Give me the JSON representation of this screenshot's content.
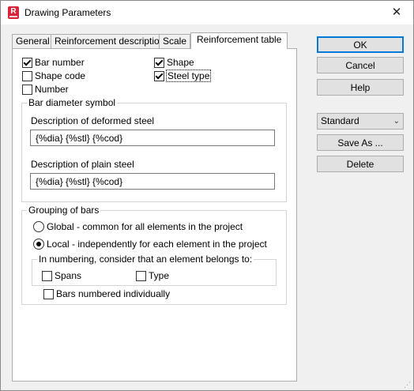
{
  "window": {
    "title": "Drawing Parameters",
    "app_icon_letter": "R"
  },
  "tabs": [
    {
      "label": "General"
    },
    {
      "label": "Reinforcement description"
    },
    {
      "label": "Scale"
    },
    {
      "label": "Reinforcement table"
    }
  ],
  "columns": {
    "bar_number": {
      "label": "Bar number",
      "checked": true
    },
    "shape_code": {
      "label": "Shape code",
      "checked": false
    },
    "number": {
      "label": "Number",
      "checked": false
    },
    "shape": {
      "label": "Shape",
      "checked": true
    },
    "steel_type": {
      "label": "Steel type",
      "checked": true
    }
  },
  "bar_diameter": {
    "group_label": "Bar diameter symbol",
    "deformed_label": "Description of deformed steel",
    "deformed_value": "{%dia} {%stl} {%cod}",
    "plain_label": "Description of plain steel",
    "plain_value": "{%dia} {%stl} {%cod}"
  },
  "grouping": {
    "group_label": "Grouping of bars",
    "global_label": "Global - common for all elements in the project",
    "local_label": "Local - independently for each element in the project",
    "selected": "local",
    "numbering_label": "In numbering, consider that an element belongs to:",
    "spans_label": "Spans",
    "type_label": "Type",
    "individual_label": "Bars numbered individually"
  },
  "buttons": {
    "ok": "OK",
    "cancel": "Cancel",
    "help": "Help",
    "save_as": "Save As ...",
    "delete": "Delete"
  },
  "preset": {
    "value": "Standard"
  },
  "accent_color": "#0078d7"
}
